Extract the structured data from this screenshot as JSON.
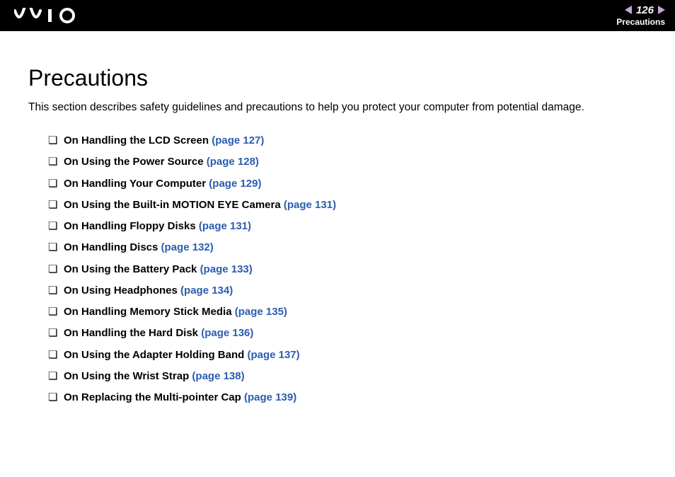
{
  "header": {
    "page_number": "126",
    "section_label": "Precautions"
  },
  "title": "Precautions",
  "intro": "This section describes safety guidelines and precautions to help you protect your computer from potential damage.",
  "toc": [
    {
      "label": "On Handling the LCD Screen",
      "page_ref": "(page 127)"
    },
    {
      "label": "On Using the Power Source",
      "page_ref": "(page 128)"
    },
    {
      "label": "On Handling Your Computer",
      "page_ref": "(page 129)"
    },
    {
      "label": "On Using the Built-in MOTION EYE Camera",
      "page_ref": "(page 131)"
    },
    {
      "label": "On Handling Floppy Disks",
      "page_ref": "(page 131)"
    },
    {
      "label": "On Handling Discs",
      "page_ref": "(page 132)"
    },
    {
      "label": "On Using the Battery Pack",
      "page_ref": "(page 133)"
    },
    {
      "label": "On Using Headphones",
      "page_ref": "(page 134)"
    },
    {
      "label": "On Handling Memory Stick Media",
      "page_ref": "(page 135)"
    },
    {
      "label": "On Handling the Hard Disk",
      "page_ref": "(page 136)"
    },
    {
      "label": "On Using the Adapter Holding Band",
      "page_ref": "(page 137)"
    },
    {
      "label": "On Using the Wrist Strap",
      "page_ref": "(page 138)"
    },
    {
      "label": "On Replacing the Multi-pointer Cap",
      "page_ref": "(page 139)"
    }
  ]
}
